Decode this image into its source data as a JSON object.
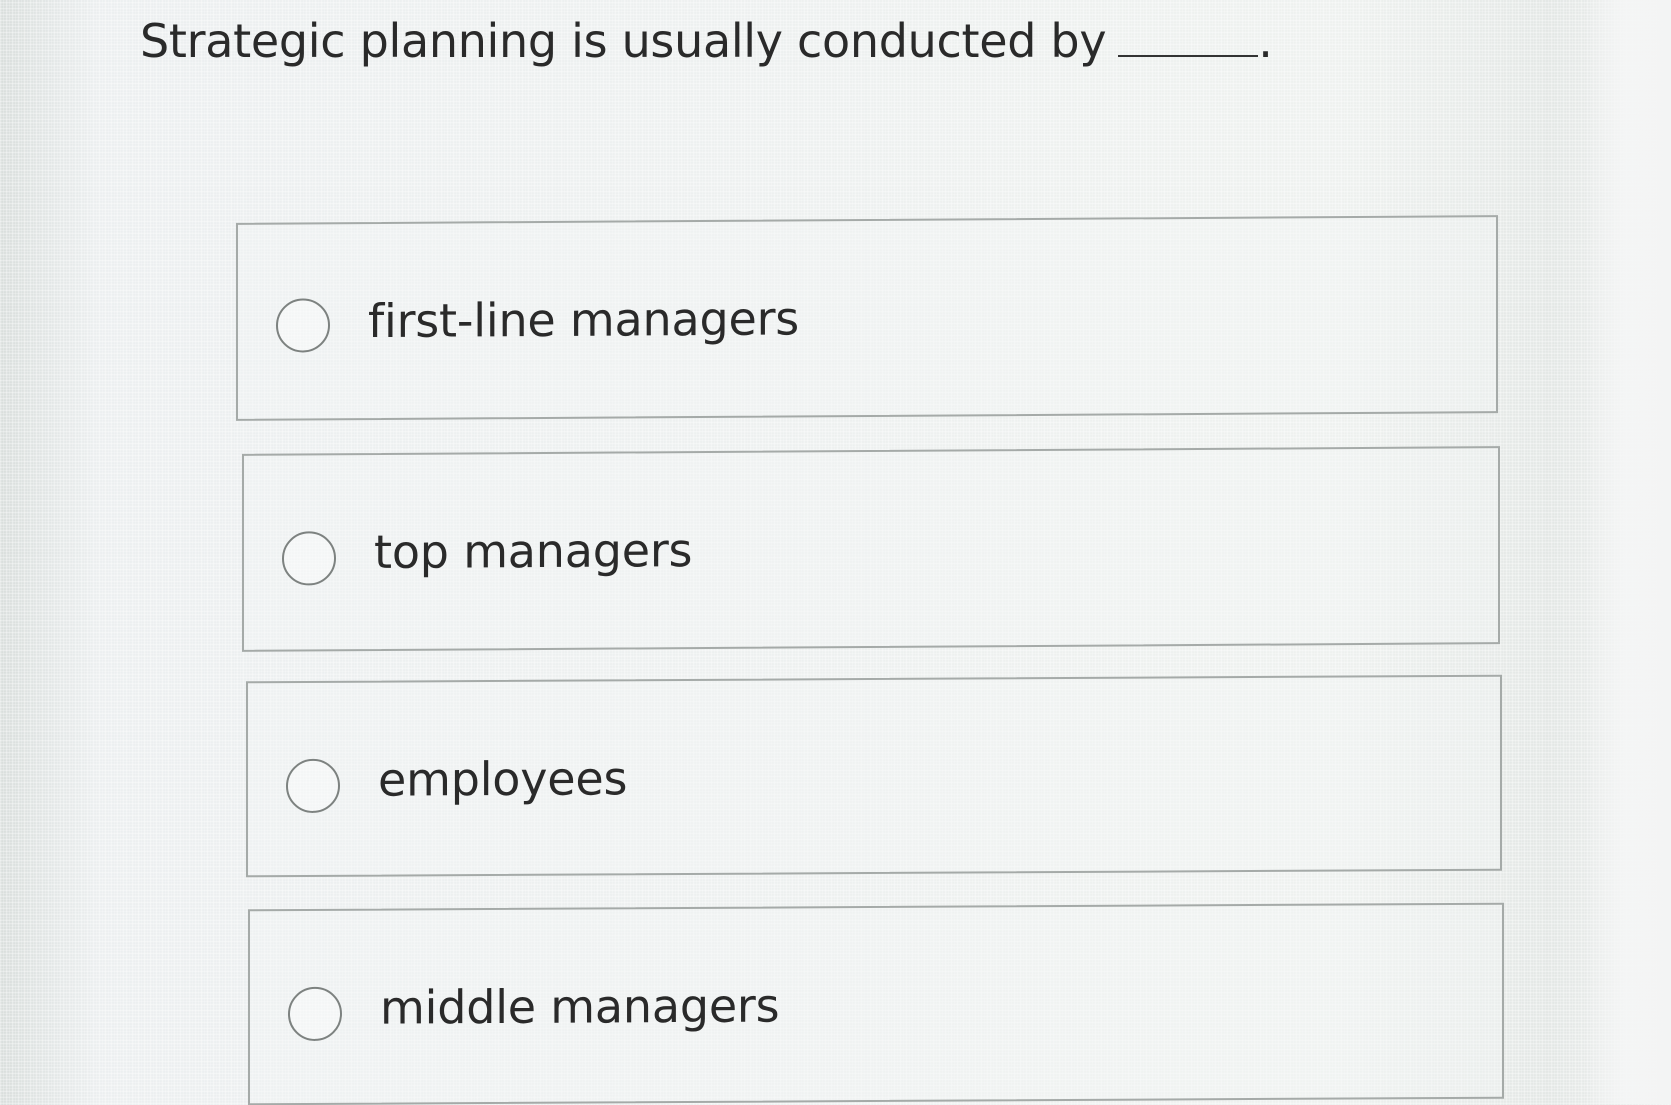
{
  "question": {
    "text": "Strategic planning is usually conducted by",
    "trailing_punct": "."
  },
  "options": [
    {
      "label": "first-line managers",
      "selected": false,
      "icon": "radio-unchecked-icon"
    },
    {
      "label": "top managers",
      "selected": false,
      "icon": "radio-unchecked-icon"
    },
    {
      "label": "employees",
      "selected": false,
      "icon": "radio-unchecked-icon"
    },
    {
      "label": "middle managers",
      "selected": false,
      "icon": "radio-unchecked-icon"
    }
  ],
  "colors": {
    "background": "#e7ecea",
    "border": "#a5aaa8",
    "text": "#2a2a2a"
  }
}
